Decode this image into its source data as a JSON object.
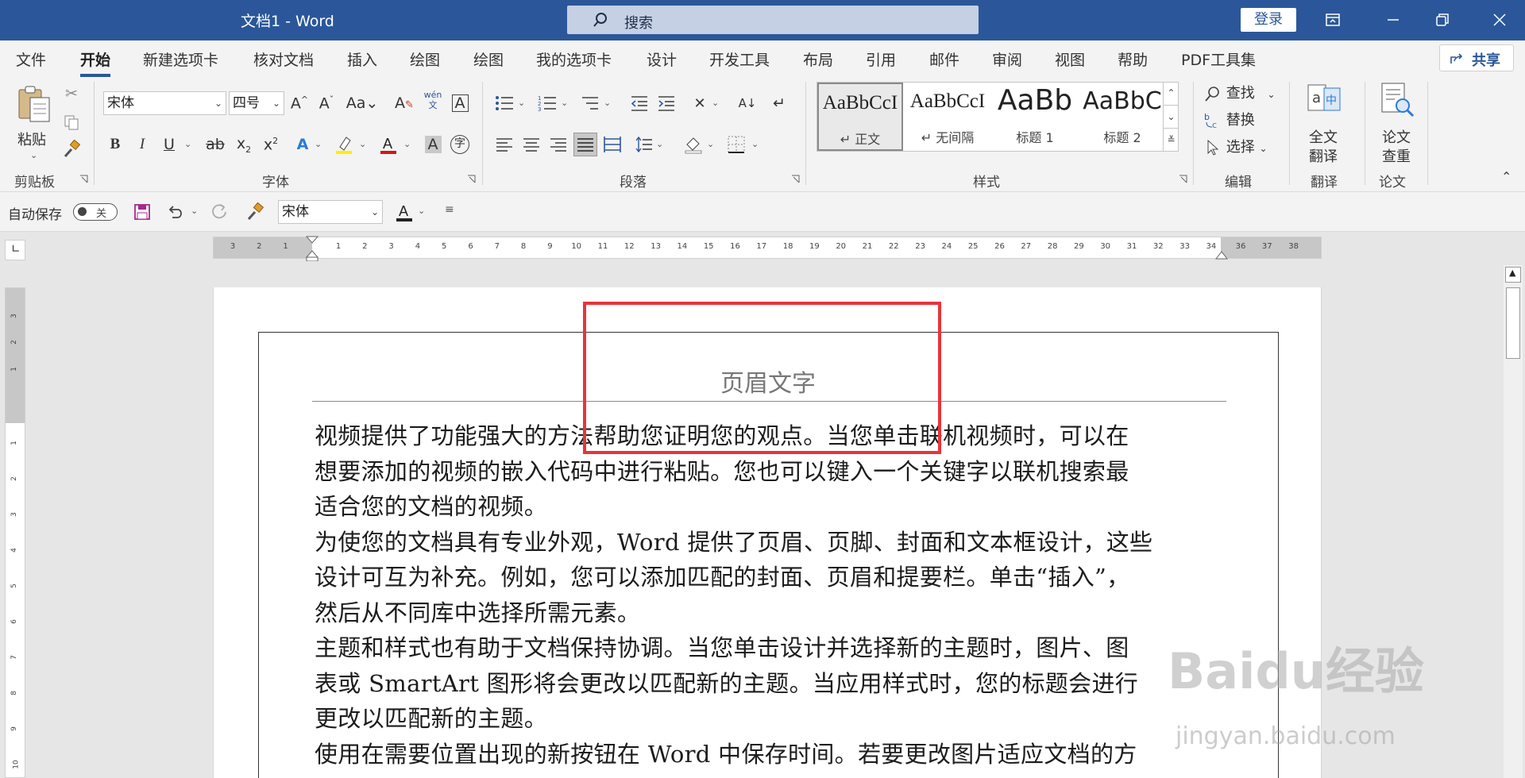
{
  "app": {
    "title": "文档1  -  Word",
    "search_placeholder": "搜索",
    "login_label": "登录"
  },
  "tabs": [
    "文件",
    "开始",
    "新建选项卡",
    "核对文档",
    "插入",
    "绘图",
    "绘图",
    "我的选项卡",
    "设计",
    "开发工具",
    "布局",
    "引用",
    "邮件",
    "审阅",
    "视图",
    "帮助",
    "PDF工具集"
  ],
  "active_tab": "开始",
  "share_label": "共享",
  "ribbon": {
    "clipboard": {
      "paste_label": "粘贴",
      "group": "剪贴板"
    },
    "font": {
      "name": "宋体",
      "size": "四号",
      "group": "字体",
      "phonetic": "wén"
    },
    "paragraph": {
      "group": "段落"
    },
    "styles": {
      "group": "样式",
      "items": [
        {
          "sample": "AaBbCcI",
          "name": "正文",
          "mark": "↵ "
        },
        {
          "sample": "AaBbCcI",
          "name": "无间隔",
          "mark": "↵ "
        },
        {
          "sample": "AaBb",
          "name": "标题 1",
          "mark": ""
        },
        {
          "sample": "AaBbC",
          "name": "标题 2",
          "mark": ""
        }
      ]
    },
    "editing": {
      "find": "查找",
      "replace": "替换",
      "select": "选择",
      "group": "编辑"
    },
    "translate": {
      "label1": "全文",
      "label2": "翻译",
      "group": "翻译"
    },
    "paper": {
      "label1": "论文",
      "label2": "查重",
      "group": "论文"
    }
  },
  "qat": {
    "autosave_label": "自动保存",
    "autosave_state": "关",
    "font": "宋体"
  },
  "ruler": {
    "h_left": [
      "3",
      "2",
      "1"
    ],
    "h_main": [
      "1",
      "2",
      "3",
      "4",
      "5",
      "6",
      "7",
      "8",
      "9",
      "10",
      "11",
      "12",
      "13",
      "14",
      "15",
      "16",
      "17",
      "18",
      "19",
      "20",
      "21",
      "22",
      "23",
      "24",
      "25",
      "26",
      "27",
      "28",
      "29",
      "30",
      "31",
      "32",
      "33",
      "34"
    ],
    "h_right": [
      "36",
      "37",
      "38"
    ],
    "v_top": [
      "3",
      "2",
      "1"
    ],
    "v_main": [
      "1",
      "2",
      "3",
      "4",
      "5",
      "6",
      "7",
      "8",
      "9",
      "10"
    ]
  },
  "document": {
    "header_text": "页眉文字",
    "lines": [
      "视频提供了功能强大的方法帮助您证明您的观点。当您单击联机视频时，可以在",
      "想要添加的视频的嵌入代码中进行粘贴。您也可以键入一个关键字以联机搜索最",
      "适合您的文档的视频。",
      "为使您的文档具有专业外观，Word 提供了页眉、页脚、封面和文本框设计，这些",
      "设计可互为补充。例如，您可以添加匹配的封面、页眉和提要栏。单击“插入”，",
      "然后从不同库中选择所需元素。",
      "主题和样式也有助于文档保持协调。当您单击设计并选择新的主题时，图片、图",
      "表或 SmartArt 图形将会更改以匹配新的主题。当应用样式时，您的标题会进行",
      "更改以匹配新的主题。",
      "使用在需要位置出现的新按钮在 Word 中保存时间。若要更改图片适应文档的方"
    ]
  },
  "watermark": {
    "brand": "Baidu经验",
    "url": "jingyan.baidu.com"
  },
  "colors": {
    "titlebar": "#2b579a",
    "highlight_box": "#e8343a"
  }
}
